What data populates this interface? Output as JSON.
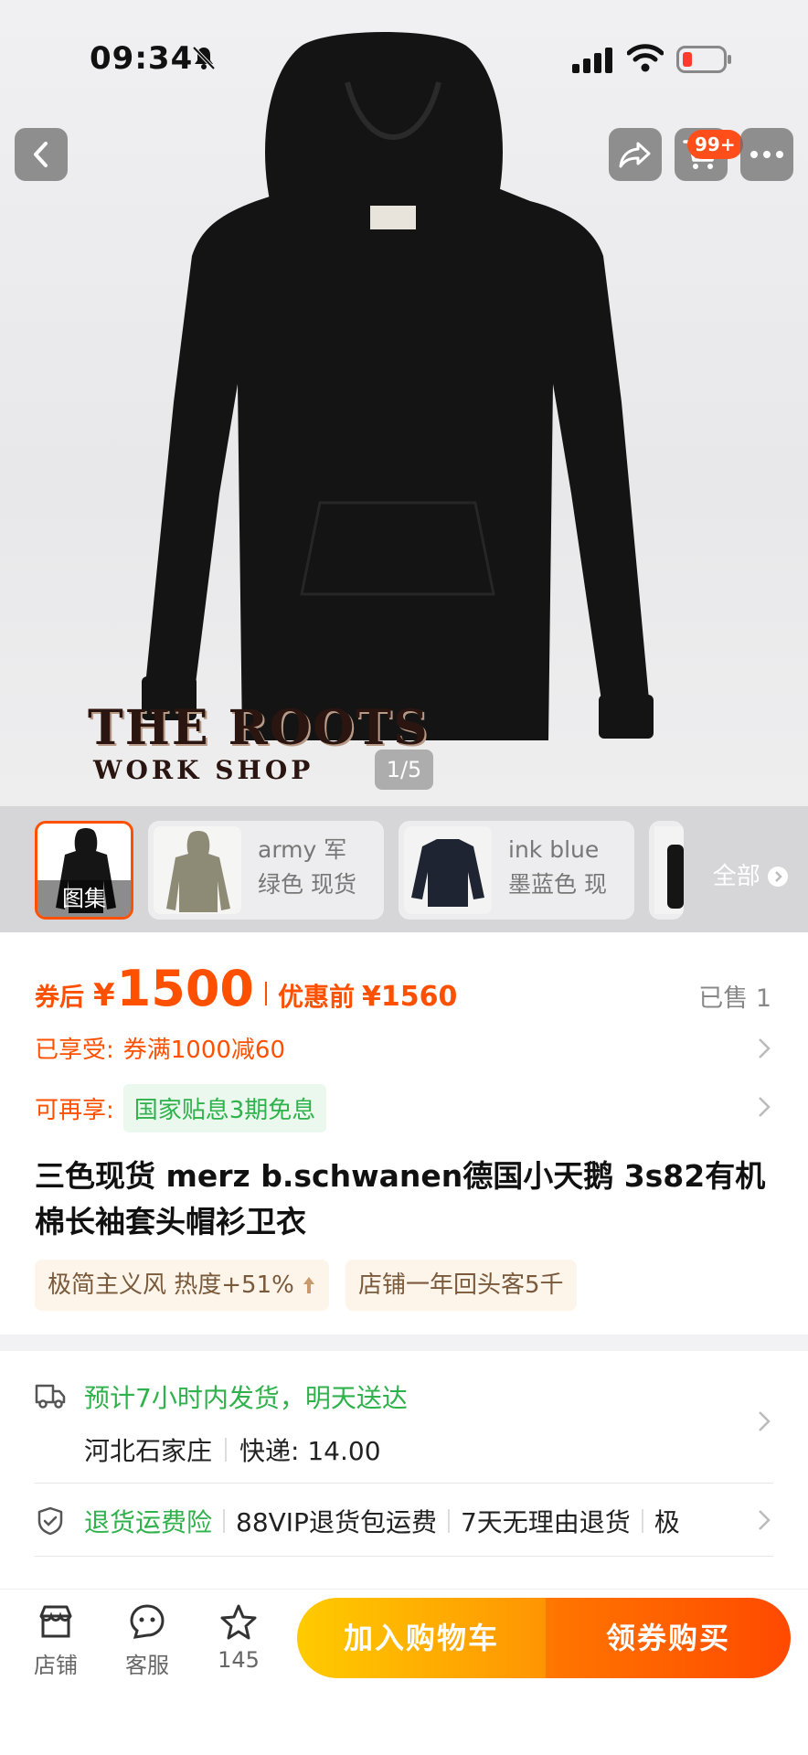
{
  "status_bar": {
    "time": "09:34"
  },
  "hero": {
    "brand_line1": "THE ROOTS",
    "brand_line2": "WORK SHOP",
    "pager": "1/5",
    "cart_badge": "99+"
  },
  "thumbnails": {
    "gallery_label": "图集",
    "items": [
      {
        "line1": "army 军",
        "line2": "绿色 现货"
      },
      {
        "line1": "ink blue",
        "line2": "墨蓝色 现"
      }
    ],
    "all_label": "全部"
  },
  "price": {
    "after_coupon_label": "券后",
    "currency": "¥",
    "after_coupon_value": "1500",
    "before_label": "优惠前",
    "before_value": "¥1560",
    "sold": "已售 1"
  },
  "promos": [
    {
      "prefix": "已享受:",
      "text": "券满1000减60"
    },
    {
      "prefix": "可再享:",
      "text": "国家贴息3期免息"
    }
  ],
  "title": "三色现货 merz b.schwanen德国小天鹅 3s82有机棉长袖套头帽衫卫衣",
  "tags": [
    "极简主义风 热度+51%",
    "店铺一年回头客5千"
  ],
  "shipping": {
    "estimate": "预计7小时内发货，明天送达",
    "origin": "河北石家庄",
    "express": "快递: 14.00"
  },
  "guarantee": {
    "insurance": "退货运费险",
    "vip": "88VIP退货包运费",
    "return": "7天无理由退货",
    "more": "极"
  },
  "bottom_bar": {
    "shop": "店铺",
    "service": "客服",
    "favorite_count": "145",
    "add_to_cart": "加入购物车",
    "buy": "领券购买"
  },
  "colors": {
    "accent": "#ff5000",
    "green": "#2fb14b",
    "cart_btn": "#ffb100",
    "buy_btn": "#ff5a00"
  }
}
